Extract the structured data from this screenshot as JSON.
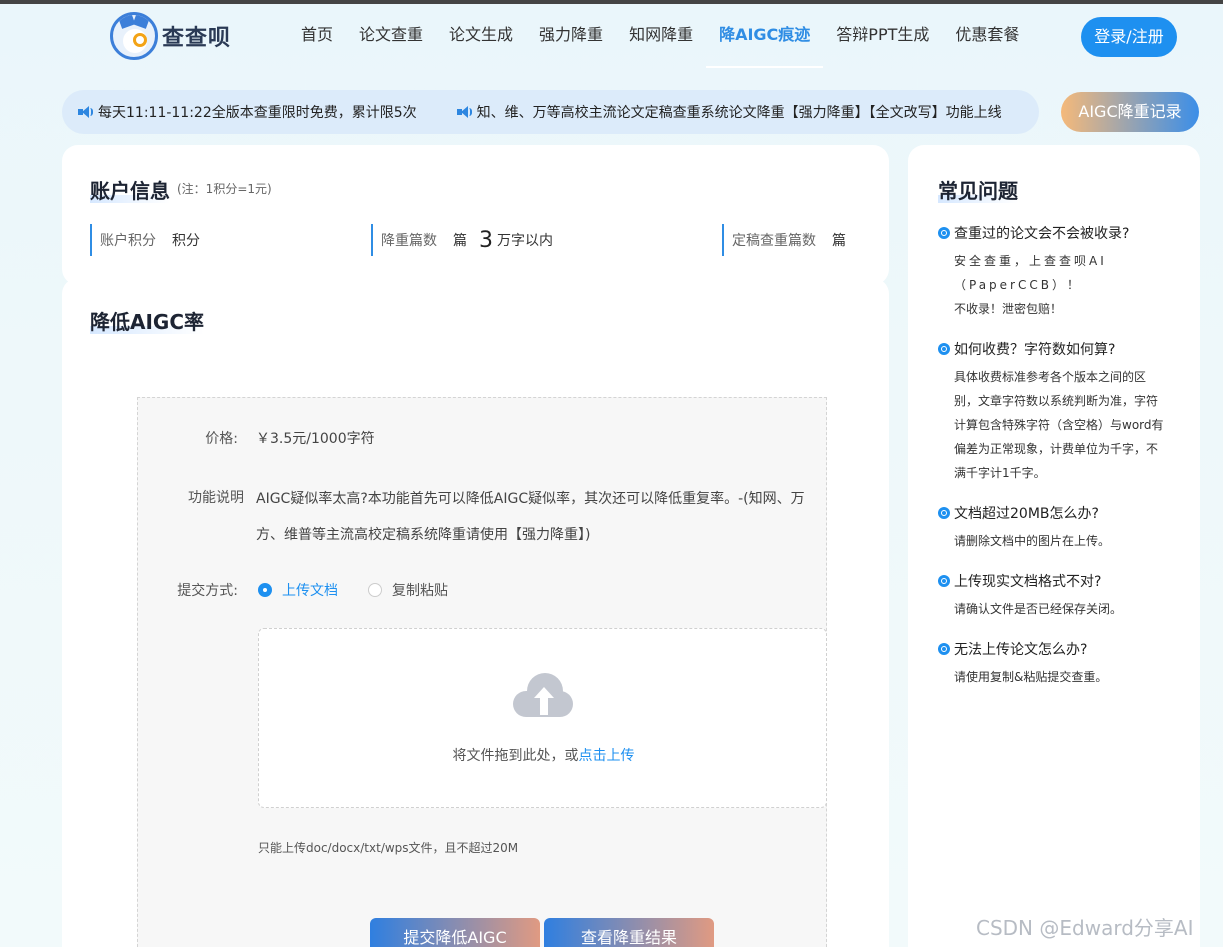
{
  "header": {
    "logo_text": "查查呗",
    "nav": [
      "首页",
      "论文查重",
      "论文生成",
      "强力降重",
      "知网降重",
      "降AIGC痕迹",
      "答辩PPT生成",
      "优惠套餐"
    ],
    "active_index": 5,
    "login_label": "登录/注册"
  },
  "notice": {
    "items": [
      "每天11:11-11:22全版本查重限时免费，累计限5次",
      "知、维、万等高校主流论文定稿查重系统论文降重【强力降重】【全文改写】功能上线"
    ],
    "record_button": "AIGC降重记录"
  },
  "account": {
    "title": "账户信息",
    "note": "(注：1积分=1元)",
    "stats": [
      {
        "label": "账户积分",
        "unit": "积分"
      },
      {
        "label": "降重篇数",
        "unit": "篇",
        "big": "3",
        "suffix": "万字以内"
      },
      {
        "label": "定稿查重篇数",
        "unit": "篇"
      }
    ]
  },
  "main": {
    "title": "降低AIGC率",
    "price_label": "价格:",
    "price_value": "￥3.5元/1000字符",
    "desc_label": "功能说明",
    "desc_value": "AIGC疑似率太高?本功能首先可以降低AIGC疑似率，其次还可以降低重复率。-(知网、万方、维普等主流高校定稿系统降重请使用【强力降重】)",
    "submit_label": "提交方式:",
    "option_upload": "上传文档",
    "option_paste": "复制粘贴",
    "upload_text": "将文件拖到此处，或",
    "upload_link": "点击上传",
    "hint": "只能上传doc/docx/txt/wps文件，且不超过20M",
    "btn_submit": "提交降低AIGC",
    "btn_result": "查看降重结果"
  },
  "faq": {
    "title": "常见问题",
    "items": [
      {
        "q": "查重过的论文会不会被收录?",
        "a": [
          "安全查重，上查查呗AI（PaperCCB）！",
          "不收录！泄密包赔！"
        ]
      },
      {
        "q": "如何收费？字符数如何算?",
        "a": [
          "具体收费标准参考各个版本之间的区别，文章字符数以系统判断为准，字符计算包含特殊字符（含空格）与word有偏差为正常现象，计费单位为千字，不满千字计1千字。"
        ]
      },
      {
        "q": "文档超过20MB怎么办?",
        "a": [
          "请删除文档中的图片在上传。"
        ]
      },
      {
        "q": "上传现实文档格式不对?",
        "a": [
          "请确认文件是否已经保存关闭。"
        ]
      },
      {
        "q": "无法上传论文怎么办?",
        "a": [
          "请使用复制&粘贴提交查重。"
        ]
      }
    ]
  },
  "watermark": "CSDN @Edward分享AI"
}
